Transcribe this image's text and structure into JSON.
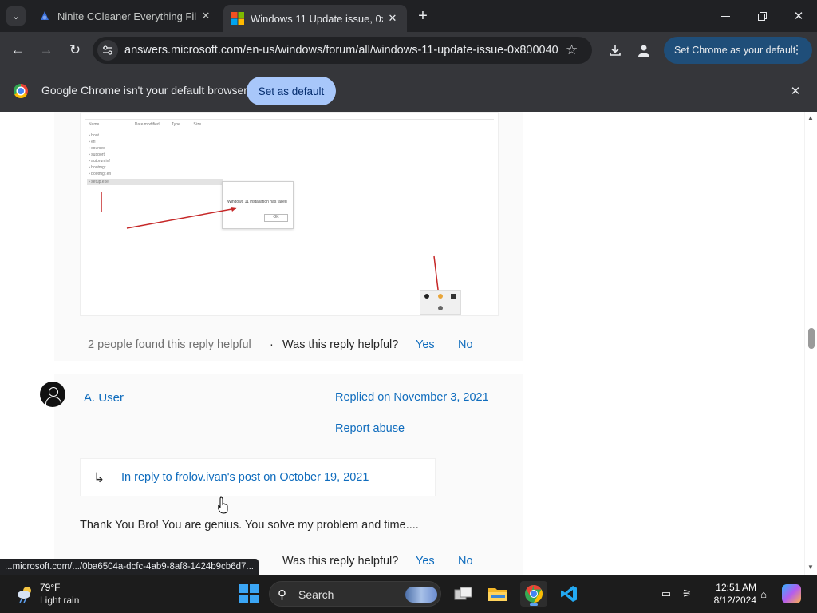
{
  "browser": {
    "tabs": [
      {
        "title": "Ninite CCleaner Everything File..."
      },
      {
        "title": "Windows 11 Update issue, 0x80..."
      }
    ],
    "url": "answers.microsoft.com/en-us/windows/forum/all/windows-11-update-issue-0x800040...",
    "set_default_pill": "Set Chrome as your default",
    "infobar": {
      "message": "Google Chrome isn't your default browser",
      "button": "Set as default"
    }
  },
  "page": {
    "first_reply": {
      "helpful_count": "2 people found this reply helpful",
      "separator": "·",
      "question": "Was this reply helpful?",
      "yes": "Yes",
      "no": "No"
    },
    "second_reply": {
      "username": "A. User",
      "replied_on": "Replied on November 3, 2021",
      "report": "Report abuse",
      "in_reply_to": "In reply to frolov.ivan's post on October 19, 2021",
      "body": "Thank You Bro! You are genius. You solve my problem and time....",
      "question": "Was this reply helpful?",
      "yes": "Yes",
      "no": "No"
    },
    "embedded_screenshot": {
      "dialog_text": "Windows 11 installation has failed",
      "ok": "OK"
    }
  },
  "status_link": "...microsoft.com/.../0ba6504a-dcfc-4ab9-8af8-1424b9cb6d7...",
  "taskbar": {
    "temperature": "79°F",
    "condition": "Light rain",
    "search_label": "Search",
    "time": "12:51 AM",
    "date": "8/12/2024"
  },
  "colors": {
    "link": "#0f6cbd",
    "chrome_dark": "#202124",
    "toolbar": "#35363a",
    "infobar_button": "#a8c7fa",
    "default_pill": "#1f4e79"
  }
}
